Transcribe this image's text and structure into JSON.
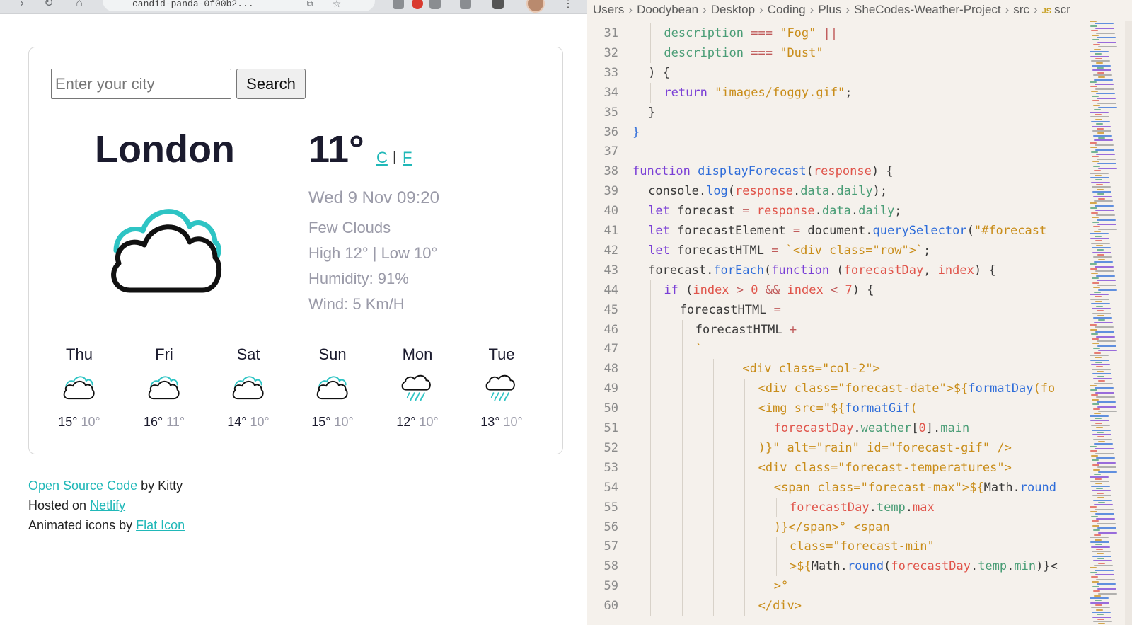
{
  "browser": {
    "address": "candid-panda-0f00b2...",
    "search": {
      "placeholder": "Enter your city",
      "button_label": "Search"
    },
    "current": {
      "city": "London",
      "temperature": "11°",
      "unit_celsius": "C",
      "unit_separator": "|",
      "unit_fahrenheit": "F",
      "date_time": "Wed 9 Nov 09:20",
      "description": "Few Clouds",
      "high_low": "High 12° | Low 10°",
      "humidity": "Humidity: 91%",
      "wind": "Wind: 5 Km/H",
      "icon": "cloudy-icon",
      "icon_colors": {
        "back": "#2ec4c4",
        "front": "#111111"
      }
    },
    "forecast": [
      {
        "day": "Thu",
        "max": "15°",
        "min": "10°",
        "icon": "cloudy-icon"
      },
      {
        "day": "Fri",
        "max": "16°",
        "min": "11°",
        "icon": "cloudy-icon"
      },
      {
        "day": "Sat",
        "max": "14°",
        "min": "10°",
        "icon": "cloudy-icon"
      },
      {
        "day": "Sun",
        "max": "15°",
        "min": "10°",
        "icon": "cloudy-icon"
      },
      {
        "day": "Mon",
        "max": "12°",
        "min": "10°",
        "icon": "rain-icon"
      },
      {
        "day": "Tue",
        "max": "13°",
        "min": "10°",
        "icon": "rain-icon"
      }
    ],
    "footer": {
      "line1": {
        "link": "Open Source Code ",
        "text": "by Kitty"
      },
      "line2": {
        "text": "Hosted on ",
        "link": "Netlify"
      },
      "line3": {
        "text": "Animated icons by ",
        "link": "Flat Icon"
      }
    },
    "accent_color": "#20b8b8"
  },
  "editor": {
    "breadcrumb": [
      "Users",
      "Doodybean",
      "Desktop",
      "Coding",
      "Plus",
      "SheCodes-Weather-Project",
      "src"
    ],
    "file_badge": "JS",
    "file_name": "scr",
    "lines": [
      {
        "no": "31",
        "ind": 2,
        "tok": [
          [
            "t-prop",
            "description"
          ],
          [
            "t-p",
            " "
          ],
          [
            "t-op",
            "==="
          ],
          [
            "t-p",
            " "
          ],
          [
            "t-str",
            "\"Fog\""
          ],
          [
            "t-p",
            " "
          ],
          [
            "t-op",
            "||"
          ]
        ]
      },
      {
        "no": "32",
        "ind": 2,
        "tok": [
          [
            "t-prop",
            "description"
          ],
          [
            "t-p",
            " "
          ],
          [
            "t-op",
            "==="
          ],
          [
            "t-p",
            " "
          ],
          [
            "t-str",
            "\"Dust\""
          ]
        ]
      },
      {
        "no": "33",
        "ind": 1,
        "tok": [
          [
            "t-p",
            ") {"
          ]
        ]
      },
      {
        "no": "34",
        "ind": 2,
        "tok": [
          [
            "t-kw",
            "return"
          ],
          [
            "t-p",
            " "
          ],
          [
            "t-str",
            "\"images/foggy.gif\""
          ],
          [
            "t-p",
            ";"
          ]
        ]
      },
      {
        "no": "35",
        "ind": 1,
        "tok": [
          [
            "t-p",
            "}"
          ]
        ]
      },
      {
        "no": "36",
        "ind": 0,
        "tok": [
          [
            "t-fn",
            "}"
          ]
        ]
      },
      {
        "no": "37",
        "ind": 0,
        "tok": []
      },
      {
        "no": "38",
        "ind": 0,
        "tok": [
          [
            "t-kw",
            "function"
          ],
          [
            "t-p",
            " "
          ],
          [
            "t-fn",
            "displayForecast"
          ],
          [
            "t-p",
            "("
          ],
          [
            "t-var",
            "response"
          ],
          [
            "t-p",
            ") {"
          ]
        ]
      },
      {
        "no": "39",
        "ind": 1,
        "tok": [
          [
            "t-p",
            "console."
          ],
          [
            "t-fn",
            "log"
          ],
          [
            "t-p",
            "("
          ],
          [
            "t-var",
            "response"
          ],
          [
            "t-p",
            "."
          ],
          [
            "t-prop",
            "data"
          ],
          [
            "t-p",
            "."
          ],
          [
            "t-prop",
            "daily"
          ],
          [
            "t-p",
            ");"
          ]
        ]
      },
      {
        "no": "40",
        "ind": 1,
        "tok": [
          [
            "t-kw",
            "let"
          ],
          [
            "t-p",
            " forecast "
          ],
          [
            "t-op",
            "="
          ],
          [
            "t-p",
            " "
          ],
          [
            "t-var",
            "response"
          ],
          [
            "t-p",
            "."
          ],
          [
            "t-prop",
            "data"
          ],
          [
            "t-p",
            "."
          ],
          [
            "t-prop",
            "daily"
          ],
          [
            "t-p",
            ";"
          ]
        ]
      },
      {
        "no": "41",
        "ind": 1,
        "tok": [
          [
            "t-kw",
            "let"
          ],
          [
            "t-p",
            " forecastElement "
          ],
          [
            "t-op",
            "="
          ],
          [
            "t-p",
            " document."
          ],
          [
            "t-fn",
            "querySelector"
          ],
          [
            "t-p",
            "("
          ],
          [
            "t-str",
            "\"#forecast"
          ]
        ]
      },
      {
        "no": "42",
        "ind": 1,
        "tok": [
          [
            "t-kw",
            "let"
          ],
          [
            "t-p",
            " forecastHTML "
          ],
          [
            "t-op",
            "="
          ],
          [
            "t-p",
            " "
          ],
          [
            "t-str",
            "`<div class=\"row\">`"
          ],
          [
            "t-p",
            ";"
          ]
        ]
      },
      {
        "no": "43",
        "ind": 1,
        "tok": [
          [
            "t-p",
            "forecast."
          ],
          [
            "t-fn",
            "forEach"
          ],
          [
            "t-p",
            "("
          ],
          [
            "t-kw",
            "function"
          ],
          [
            "t-p",
            " ("
          ],
          [
            "t-var",
            "forecastDay"
          ],
          [
            "t-p",
            ", "
          ],
          [
            "t-var",
            "index"
          ],
          [
            "t-p",
            ") {"
          ]
        ]
      },
      {
        "no": "44",
        "ind": 2,
        "tok": [
          [
            "t-kw",
            "if"
          ],
          [
            "t-p",
            " ("
          ],
          [
            "t-var",
            "index"
          ],
          [
            "t-p",
            " "
          ],
          [
            "t-op",
            ">"
          ],
          [
            "t-p",
            " "
          ],
          [
            "t-num",
            "0"
          ],
          [
            "t-p",
            " "
          ],
          [
            "t-op",
            "&&"
          ],
          [
            "t-p",
            " "
          ],
          [
            "t-var",
            "index"
          ],
          [
            "t-p",
            " "
          ],
          [
            "t-op",
            "<"
          ],
          [
            "t-p",
            " "
          ],
          [
            "t-num",
            "7"
          ],
          [
            "t-p",
            ") {"
          ]
        ]
      },
      {
        "no": "45",
        "ind": 3,
        "tok": [
          [
            "t-p",
            "forecastHTML "
          ],
          [
            "t-op",
            "="
          ]
        ]
      },
      {
        "no": "46",
        "ind": 4,
        "tok": [
          [
            "t-p",
            "forecastHTML "
          ],
          [
            "t-op",
            "+"
          ]
        ]
      },
      {
        "no": "47",
        "ind": 4,
        "tok": [
          [
            "t-str",
            "`"
          ]
        ]
      },
      {
        "no": "48",
        "ind": 7,
        "tok": [
          [
            "t-tag",
            "<div class=\"col-2\">"
          ]
        ]
      },
      {
        "no": "49",
        "ind": 8,
        "tok": [
          [
            "t-tag",
            "<div class=\"forecast-date\">${"
          ],
          [
            "t-fn",
            "formatDay"
          ],
          [
            "t-tag",
            "(fo"
          ]
        ]
      },
      {
        "no": "50",
        "ind": 8,
        "tok": [
          [
            "t-tag",
            "<img src=\"${"
          ],
          [
            "t-fn",
            "formatGif"
          ],
          [
            "t-tag",
            "("
          ]
        ]
      },
      {
        "no": "51",
        "ind": 9,
        "tok": [
          [
            "t-var",
            "forecastDay"
          ],
          [
            "t-p",
            "."
          ],
          [
            "t-prop",
            "weather"
          ],
          [
            "t-p",
            "["
          ],
          [
            "t-num",
            "0"
          ],
          [
            "t-p",
            "]."
          ],
          [
            "t-prop",
            "main"
          ]
        ]
      },
      {
        "no": "52",
        "ind": 8,
        "tok": [
          [
            "t-tag",
            ")}\" alt=\"rain\" id=\"forecast-gif\" />"
          ]
        ]
      },
      {
        "no": "53",
        "ind": 8,
        "tok": [
          [
            "t-tag",
            "<div class=\"forecast-temperatures\">"
          ]
        ]
      },
      {
        "no": "54",
        "ind": 9,
        "tok": [
          [
            "t-tag",
            "<span class=\"forecast-max\">${"
          ],
          [
            "t-p",
            "Math."
          ],
          [
            "t-fn",
            "round"
          ]
        ]
      },
      {
        "no": "55",
        "ind": 10,
        "tok": [
          [
            "t-var",
            "forecastDay"
          ],
          [
            "t-p",
            "."
          ],
          [
            "t-prop",
            "temp"
          ],
          [
            "t-p",
            "."
          ],
          [
            "t-var",
            "max"
          ]
        ]
      },
      {
        "no": "56",
        "ind": 9,
        "tok": [
          [
            "t-tag",
            ")}</span>° <span"
          ]
        ]
      },
      {
        "no": "57",
        "ind": 10,
        "tok": [
          [
            "t-tag",
            "class=\"forecast-min\""
          ]
        ]
      },
      {
        "no": "58",
        "ind": 10,
        "tok": [
          [
            "t-tag",
            ">${"
          ],
          [
            "t-p",
            "Math."
          ],
          [
            "t-fn",
            "round"
          ],
          [
            "t-p",
            "("
          ],
          [
            "t-var",
            "forecastDay"
          ],
          [
            "t-p",
            "."
          ],
          [
            "t-prop",
            "temp"
          ],
          [
            "t-p",
            "."
          ],
          [
            "t-prop",
            "min"
          ],
          [
            "t-p",
            ")}<"
          ]
        ]
      },
      {
        "no": "59",
        "ind": 9,
        "tok": [
          [
            "t-tag",
            ">°"
          ]
        ]
      },
      {
        "no": "60",
        "ind": 8,
        "tok": [
          [
            "t-tag",
            "</div>"
          ]
        ]
      }
    ]
  }
}
